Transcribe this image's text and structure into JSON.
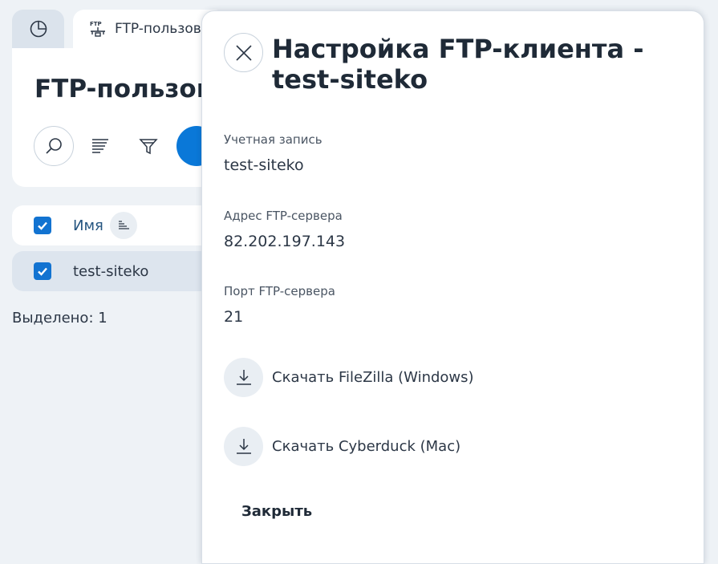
{
  "tabs": {
    "ftp_label": "FTP-пользов"
  },
  "page": {
    "title": "FTP-пользова"
  },
  "table": {
    "header": {
      "name": "Имя"
    },
    "rows": [
      {
        "name": "test-siteko",
        "checked": true
      }
    ],
    "selected_text": "Выделено: 1"
  },
  "drawer": {
    "title": "Настройка FTP-клиента - test-siteko",
    "fields": [
      {
        "label": "Учетная запись",
        "value": "test-siteko"
      },
      {
        "label": "Адрес FTP-сервера",
        "value": "82.202.197.143"
      },
      {
        "label": "Порт FTP-сервера",
        "value": "21"
      }
    ],
    "downloads": [
      {
        "label": "Скачать FileZilla (Windows)",
        "icon": "download-icon"
      },
      {
        "label": "Скачать Cyberduck (Mac)",
        "icon": "download-icon"
      }
    ],
    "close_label": "Закрыть"
  },
  "colors": {
    "accent": "#0a78d8",
    "checkbox": "#1273d1",
    "background": "#eef2f6"
  }
}
